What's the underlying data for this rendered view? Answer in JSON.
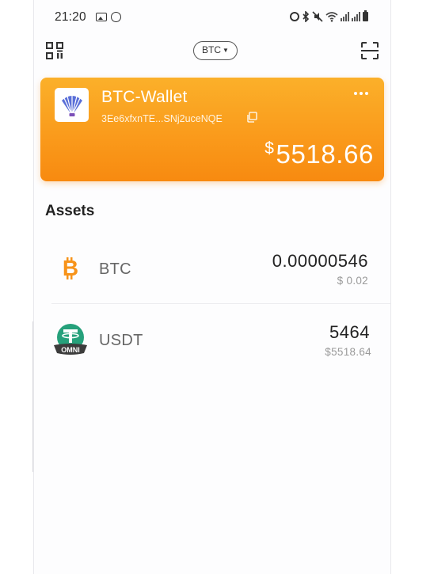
{
  "status_bar": {
    "time": "21:20",
    "icons": [
      "gallery-icon",
      "app-icon",
      "alarm-icon",
      "bluetooth-icon",
      "mute-icon",
      "wifi-icon",
      "signal-icon",
      "signal-icon",
      "battery-icon"
    ]
  },
  "header": {
    "left_icon": "qr-code-icon",
    "coin_selector": {
      "label": "BTC",
      "chevron": "chevron-down-icon"
    },
    "right_icon": "scan-icon"
  },
  "wallet": {
    "name": "BTC-Wallet",
    "address": "3Ee6xfxnTE...SNj2uceNQE",
    "currency_symbol": "$",
    "balance": "5518.66",
    "logo_icon": "shell-logo-icon",
    "copy_icon": "copy-icon",
    "more_icon": "more-icon",
    "colors": {
      "gradient_top": "#fbb02a",
      "gradient_bottom": "#f88a10"
    }
  },
  "assets": {
    "title": "Assets",
    "items": [
      {
        "symbol": "BTC",
        "amount": "0.00000546",
        "fiat": "$ 0.02",
        "icon": "bitcoin-icon",
        "color": "#f7931a"
      },
      {
        "symbol": "USDT",
        "amount": "5464",
        "fiat": "$5518.64",
        "icon": "tether-omni-icon",
        "color": "#26a17b",
        "badge": "OMNI"
      }
    ]
  }
}
